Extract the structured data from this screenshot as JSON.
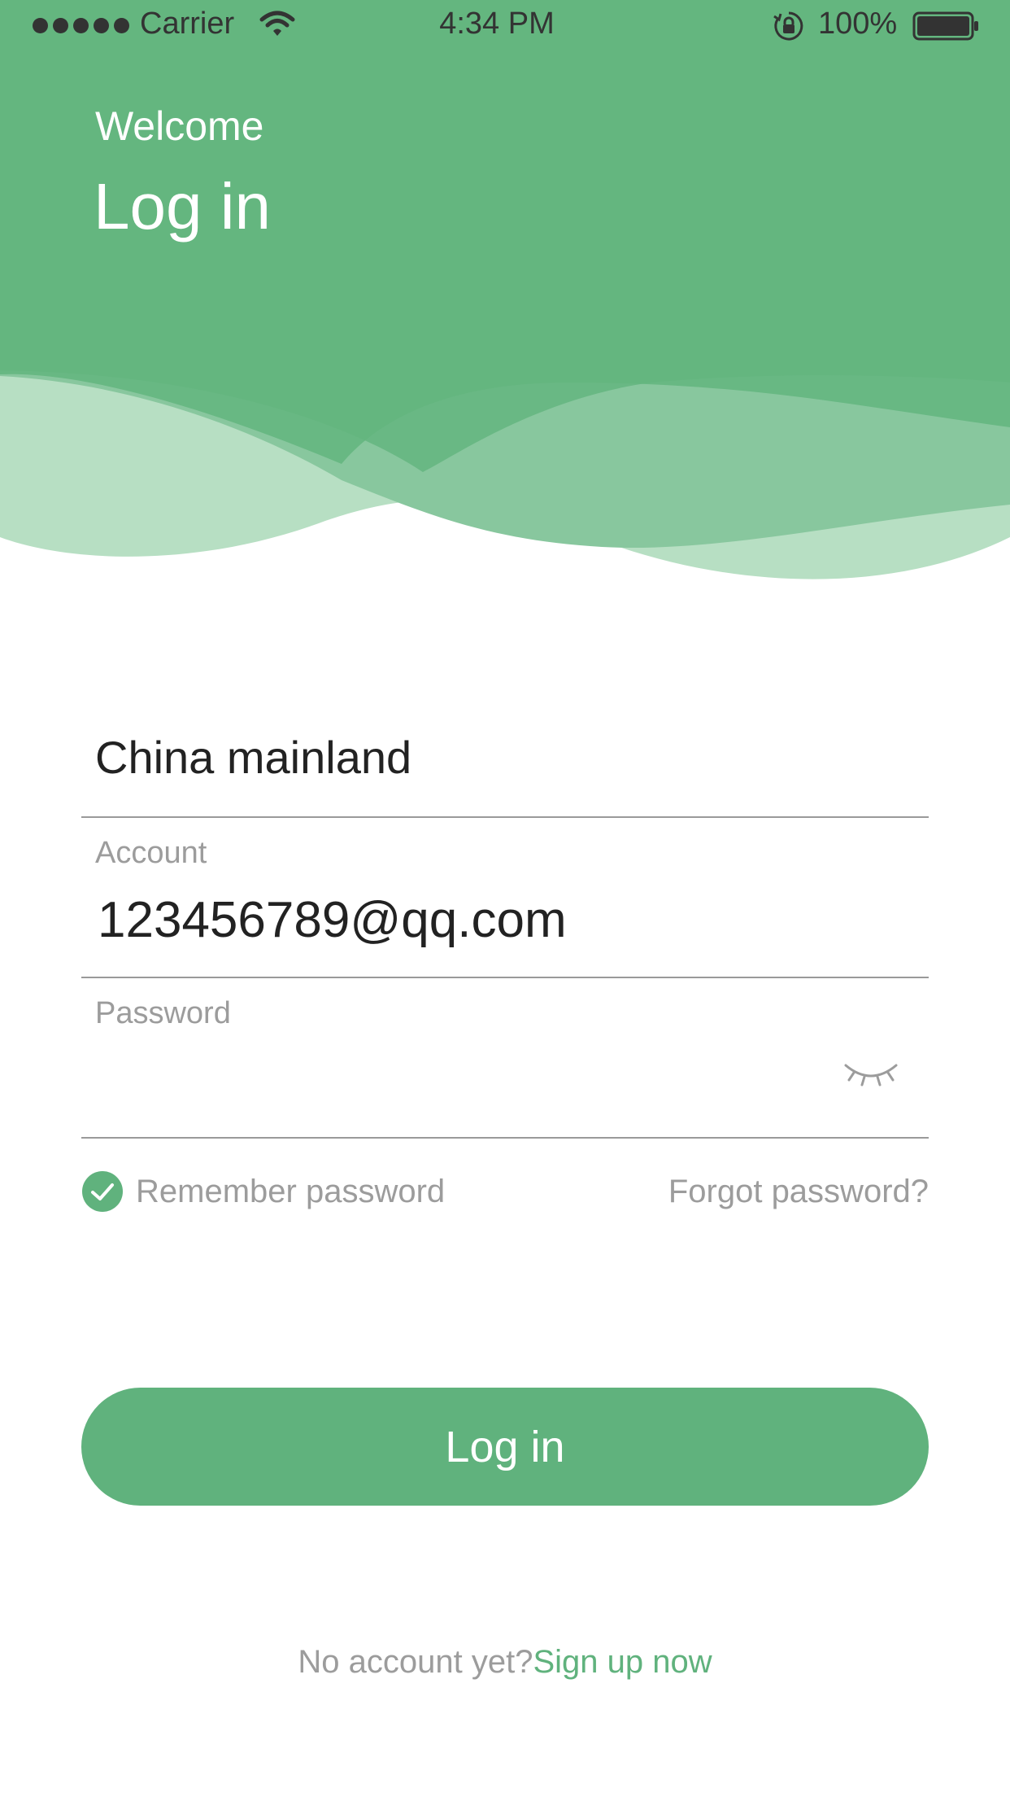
{
  "colors": {
    "accent": "#60b27d",
    "header_wave_light": "#b7dfc3",
    "header_wave_mid": "#88c79e",
    "muted_text": "#9c9c9c",
    "divider": "#9a9a9a"
  },
  "status_bar": {
    "carrier": "Carrier",
    "time": "4:34 PM",
    "battery_percent": "100%",
    "icons": [
      "signal-dots-icon",
      "wifi-icon",
      "rotation-lock-icon",
      "battery-icon"
    ]
  },
  "header": {
    "welcome": "Welcome",
    "title": "Log in"
  },
  "form": {
    "region_value": "China mainland",
    "account_label": "Account",
    "account_value": "123456789@qq.com",
    "password_label": "Password",
    "password_value": "",
    "password_toggle_icon": "eye-closed-icon",
    "remember_checked": true,
    "remember_label": "Remember password",
    "forgot_label": "Forgot password?"
  },
  "login_button_label": "Log in",
  "signup": {
    "prompt": "No account yet?",
    "link": "Sign up now"
  }
}
